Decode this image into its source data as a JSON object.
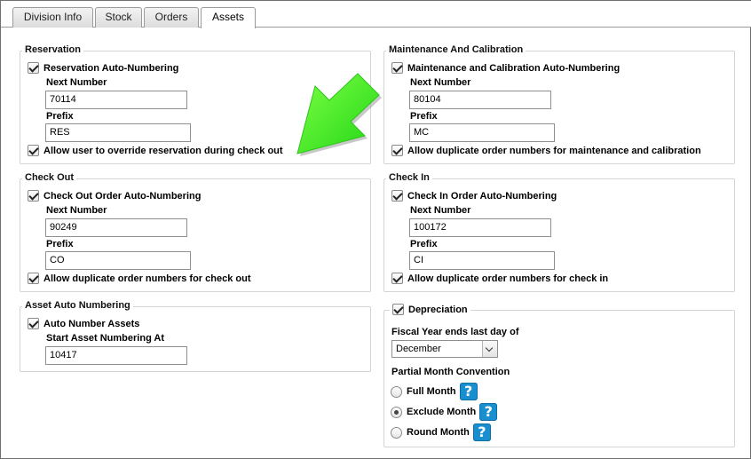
{
  "tabs": [
    {
      "label": "Division Info"
    },
    {
      "label": "Stock"
    },
    {
      "label": "Orders"
    },
    {
      "label": "Assets"
    }
  ],
  "reservation": {
    "legend": "Reservation",
    "auto_label": "Reservation Auto-Numbering",
    "next_number_label": "Next Number",
    "next_number_value": "70114",
    "prefix_label": "Prefix",
    "prefix_value": "RES",
    "override_label": "Allow user to override reservation during check out"
  },
  "maintenance": {
    "legend": "Maintenance And Calibration",
    "auto_label": "Maintenance and Calibration Auto-Numbering",
    "next_number_label": "Next Number",
    "next_number_value": "80104",
    "prefix_label": "Prefix",
    "prefix_value": "MC",
    "duplicate_label": "Allow duplicate order numbers for maintenance and calibration"
  },
  "checkout": {
    "legend": "Check Out",
    "auto_label": "Check Out Order Auto-Numbering",
    "next_number_label": "Next Number",
    "next_number_value": "90249",
    "prefix_label": "Prefix",
    "prefix_value": "CO",
    "duplicate_label": "Allow duplicate order numbers for check out"
  },
  "checkin": {
    "legend": "Check In",
    "auto_label": "Check In Order Auto-Numbering",
    "next_number_label": "Next Number",
    "next_number_value": "100172",
    "prefix_label": "Prefix",
    "prefix_value": "CI",
    "duplicate_label": "Allow duplicate order numbers for check in"
  },
  "asset_numbering": {
    "legend": "Asset Auto Numbering",
    "auto_label": "Auto Number Assets",
    "start_label": "Start Asset Numbering At",
    "start_value": "10417"
  },
  "depreciation": {
    "legend": "Depreciation",
    "fiscal_label": "Fiscal Year ends last day of",
    "fiscal_value": "December",
    "convention_label": "Partial Month Convention",
    "options": [
      {
        "label": "Full Month",
        "selected": false
      },
      {
        "label": "Exclude Month",
        "selected": true
      },
      {
        "label": "Round Month",
        "selected": false
      }
    ],
    "help_glyph": "?"
  },
  "colors": {
    "arrow_green": "#3ee81f",
    "help_blue": "#1a8fd0",
    "border": "#d4d4d4"
  },
  "icons": {
    "annotation": "green-arrow-icon",
    "help": "help-question-icon"
  }
}
